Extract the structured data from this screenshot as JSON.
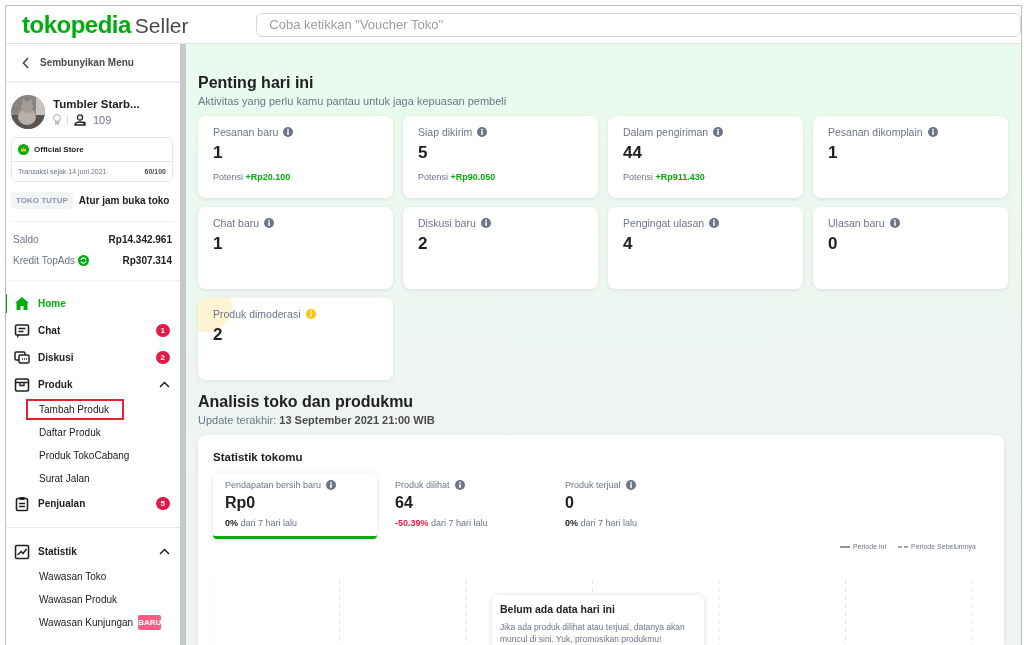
{
  "header": {
    "logo": {
      "brand": "tokopedia",
      "suffix": "Seller"
    },
    "search": {
      "placeholder": "Coba ketikkan \"Voucher Toko\""
    }
  },
  "sidebar": {
    "collapse_label": "Sembunyikan Menu",
    "shop": {
      "name": "Tumbler Starb...",
      "followers": "109"
    },
    "official": {
      "label": "Official Store",
      "since": "Transaksi sejak 14 juni 2021",
      "score": "60/100"
    },
    "status": {
      "tag": "TOKO TUTUP",
      "link": "Atur jam buka toko"
    },
    "balances": [
      {
        "label": "Saldo",
        "value": "Rp14.342.961",
        "kind": "plain"
      },
      {
        "label": "Kredit TopAds",
        "value": "Rp307.314",
        "kind": "topads"
      }
    ],
    "nav": [
      {
        "label": "Home",
        "kind": "home",
        "selected": true
      },
      {
        "label": "Chat",
        "kind": "chat",
        "selected": false,
        "badge": "1"
      },
      {
        "label": "Diskusi",
        "kind": "discussion",
        "selected": false,
        "badge": "2"
      },
      {
        "label": "Produk",
        "kind": "box",
        "selected": false,
        "expanded": true,
        "children": [
          {
            "label": "Tambah Produk",
            "highlighted": true
          },
          {
            "label": "Daftar Produk",
            "highlighted": false
          },
          {
            "label": "Produk TokoCabang",
            "highlighted": false
          },
          {
            "label": "Surat Jalan",
            "highlighted": false
          }
        ]
      },
      {
        "label": "Penjualan",
        "kind": "clipboard",
        "selected": false,
        "badge": "5"
      },
      {
        "label": "Statistik",
        "kind": "chart",
        "selected": false,
        "expanded": true,
        "group_start": true,
        "children": [
          {
            "label": "Wawasan Toko",
            "highlighted": false
          },
          {
            "label": "Wawasan Produk",
            "highlighted": false
          },
          {
            "label": "Wawasan Kunjungan",
            "highlighted": false,
            "tag": "BARU"
          }
        ]
      }
    ]
  },
  "today": {
    "title": "Penting hari ini",
    "subtitle": "Aktivitas yang perlu kamu pantau untuk jaga kepuasan pembeli",
    "cards": [
      {
        "label": "Pesanan baru",
        "value": "1",
        "kind": "normal",
        "potential_label": "Potensi",
        "potential_value": "+Rp20.100"
      },
      {
        "label": "Siap dikirim",
        "value": "5",
        "kind": "normal",
        "potential_label": "Potensi",
        "potential_value": "+Rp90.050"
      },
      {
        "label": "Dalam pengiriman",
        "value": "44",
        "kind": "normal",
        "potential_label": "Potensi",
        "potential_value": "+Rp911.430"
      },
      {
        "label": "Pesanan dikomplain",
        "value": "1",
        "kind": "normal"
      },
      {
        "label": "Chat baru",
        "value": "1",
        "kind": "normal"
      },
      {
        "label": "Diskusi baru",
        "value": "2",
        "kind": "normal"
      },
      {
        "label": "Pengingat ulasan",
        "value": "4",
        "kind": "normal"
      },
      {
        "label": "Ulasan baru",
        "value": "0",
        "kind": "normal"
      },
      {
        "label": "Produk dimoderasi",
        "value": "2",
        "kind": "warning"
      }
    ]
  },
  "analysis": {
    "title": "Analisis toko dan produkmu",
    "update_label": "Update terakhir:",
    "update_time": "13 September 2021 21:00 WIB",
    "stats": {
      "title": "Statistik tokomu",
      "metrics": [
        {
          "label": "Pendapatan bersih baru",
          "value": "Rp0",
          "change": "0%",
          "kind": "neutral",
          "suffix": "dari 7 hari lalu",
          "selected": true
        },
        {
          "label": "Produk dilihat",
          "value": "64",
          "change": "-50.39%",
          "kind": "negative",
          "suffix": "dari 7 hari lalu",
          "selected": false
        },
        {
          "label": "Produk terjual",
          "value": "0",
          "change": "0%",
          "kind": "neutral",
          "suffix": "dari 7 hari lalu",
          "selected": false
        }
      ],
      "legend": [
        {
          "label": "Periode ini",
          "kind": "solid"
        },
        {
          "label": "Periode Sebelumnya",
          "kind": "dashed"
        }
      ],
      "empty": {
        "title": "Belum ada data hari ini",
        "text": "Jika ada produk dilihat atau terjual, datanya akan muncul di sini. Yuk, promosikan produkmu!"
      }
    }
  }
}
